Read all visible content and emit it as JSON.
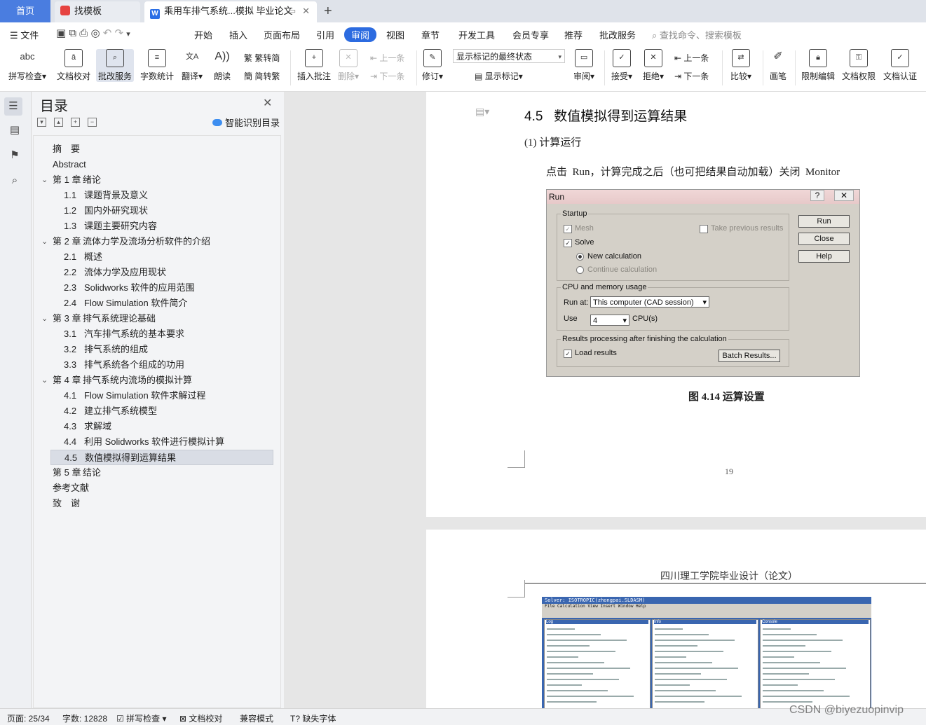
{
  "tabs": {
    "home": "首页",
    "template": "找模板",
    "document": "乘用车排气系统...模拟 毕业论文",
    "add": "+"
  },
  "menu": {
    "file": "文件",
    "items": [
      "开始",
      "插入",
      "页面布局",
      "引用",
      "审阅",
      "视图",
      "章节",
      "开发工具",
      "会员专享",
      "推荐",
      "批改服务"
    ],
    "active": "审阅",
    "search_placeholder": "查找命令、搜索模板"
  },
  "ribbon": {
    "spell": "拼写检查",
    "proofread": "文档校对",
    "correct_service": "批改服务",
    "word_count": "字数统计",
    "translate": "翻译",
    "read_aloud": "朗读",
    "to_traditional": "繁转简",
    "to_simplified": "简转繁",
    "insert_comment": "插入批注",
    "delete": "删除",
    "prev": "上一条",
    "next": "下一条",
    "revise": "修订",
    "mark_state": "显示标记的最终状态",
    "show_marks": "显示标记",
    "review": "审阅",
    "accept": "接受",
    "reject": "拒绝",
    "prev2": "上一条",
    "next2": "下一条",
    "compare": "比较",
    "pen": "画笔",
    "restrict": "限制编辑",
    "permission": "文档权限",
    "certify": "文档认证"
  },
  "toc": {
    "title": "目录",
    "smart": "智能识别目录",
    "items": [
      {
        "num": "",
        "text": "摘　要",
        "level": 0
      },
      {
        "num": "",
        "text": "Abstract",
        "level": 0
      },
      {
        "num": "第 1 章",
        "text": "绪论",
        "level": 0,
        "arrow": true
      },
      {
        "num": "1.1",
        "text": "课题背景及意义",
        "level": 1
      },
      {
        "num": "1.2",
        "text": "国内外研究现状",
        "level": 1
      },
      {
        "num": "1.3",
        "text": "课题主要研究内容",
        "level": 1
      },
      {
        "num": "第 2 章",
        "text": "流体力学及流场分析软件的介绍",
        "level": 0,
        "arrow": true
      },
      {
        "num": "2.1",
        "text": "概述",
        "level": 1
      },
      {
        "num": "2.2",
        "text": "流体力学及应用现状",
        "level": 1
      },
      {
        "num": "2.3",
        "text": "Solidworks 软件的应用范围",
        "level": 1
      },
      {
        "num": "2.4",
        "text": "Flow Simulation  软件简介",
        "level": 1
      },
      {
        "num": "第 3 章",
        "text": "排气系统理论基础",
        "level": 0,
        "arrow": true
      },
      {
        "num": "3.1",
        "text": "汽车排气系统的基本要求",
        "level": 1
      },
      {
        "num": "3.2",
        "text": "排气系统的组成",
        "level": 1
      },
      {
        "num": "3.3",
        "text": "排气系统各个组成的功用",
        "level": 1
      },
      {
        "num": "第 4 章",
        "text": "排气系统内流场的模拟计算",
        "level": 0,
        "arrow": true
      },
      {
        "num": "4.1",
        "text": "Flow Simulation 软件求解过程",
        "level": 1
      },
      {
        "num": "4.2",
        "text": "建立排气系统模型",
        "level": 1
      },
      {
        "num": "4.3",
        "text": "求解域",
        "level": 1
      },
      {
        "num": "4.4",
        "text": "利用 Solidworks 软件进行模拟计算",
        "level": 1
      },
      {
        "num": "4.5",
        "text": "数值模拟得到运算结果",
        "level": 1,
        "selected": true
      },
      {
        "num": "第 5 章",
        "text": "结论",
        "level": 0
      },
      {
        "num": "",
        "text": "参考文献",
        "level": 0
      },
      {
        "num": "",
        "text": "致　谢",
        "level": 0
      }
    ]
  },
  "doc": {
    "heading_num": "4.5",
    "heading": "数值模拟得到运算结果",
    "sub": "(1) 计算运行",
    "para": "点击  Run，计算完成之后（也可把结果自动加载）关闭  Monitor",
    "caption": "图 4.14 运算设置",
    "page_number": "19",
    "page2_header": "四川理工学院毕业设计（论文）"
  },
  "run_dialog": {
    "title": "Run",
    "startup": "Startup",
    "mesh": "Mesh",
    "take_prev": "Take previous results",
    "solve": "Solve",
    "new_calc": "New calculation",
    "continue_calc": "Continue calculation",
    "cpu_group": "CPU and memory usage",
    "run_at": "Run at:",
    "run_at_value": "This computer (CAD session)",
    "use": "Use",
    "use_value": "4",
    "cpus": "CPU(s)",
    "results_group": "Results processing after finishing the calculation",
    "load_results": "Load results",
    "batch": "Batch Results...",
    "btn_run": "Run",
    "btn_close": "Close",
    "btn_help": "Help"
  },
  "solver": {
    "title": "Solver: ISOTROPIC(zhongpai.SLDASM)",
    "menu": "File  Calculation  View  Insert  Window  Help",
    "log": "Log",
    "info": "Info",
    "console": "Console"
  },
  "status": {
    "page": "页面: 25/34",
    "words": "字数: 12828",
    "spell": "拼写检查",
    "proof": "文档校对",
    "compat": "兼容模式",
    "missing_font": "缺失字体"
  },
  "watermark": "CSDN @biyezuopinvip"
}
